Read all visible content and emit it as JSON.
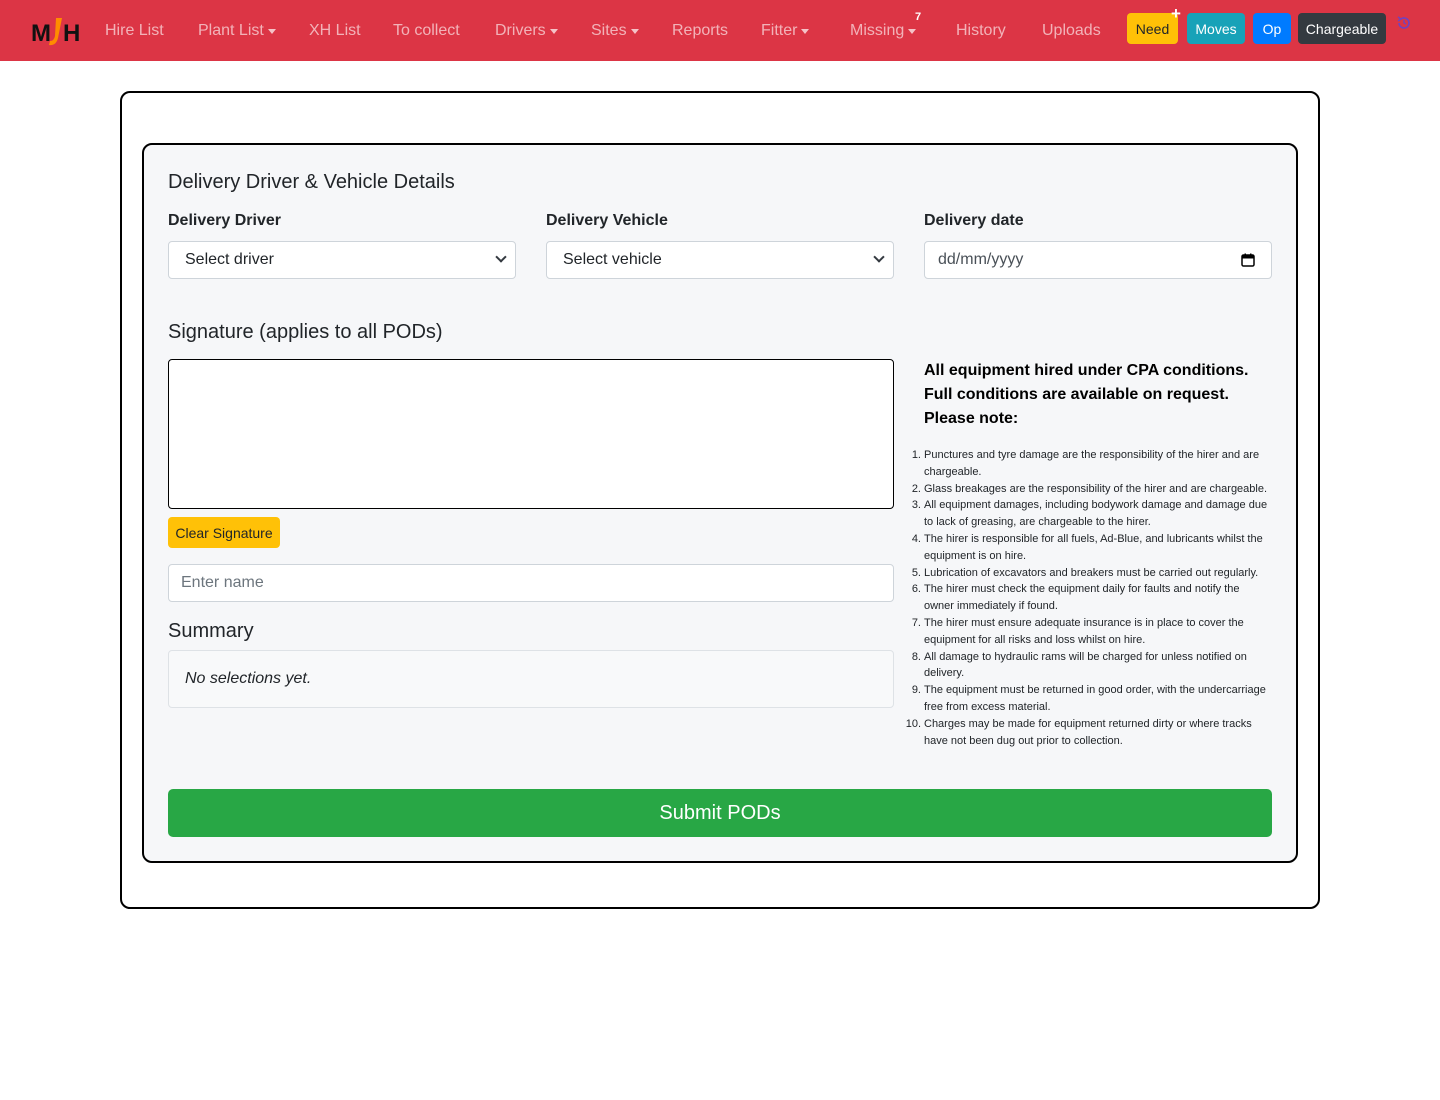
{
  "nav": {
    "brand": "MJH",
    "items": [
      {
        "label": "Hire List",
        "dropdown": false
      },
      {
        "label": "Plant List",
        "dropdown": true
      },
      {
        "label": "XH List",
        "dropdown": false
      },
      {
        "label": "To collect",
        "dropdown": false
      },
      {
        "label": "Drivers",
        "dropdown": true
      },
      {
        "label": "Sites",
        "dropdown": true
      },
      {
        "label": "Reports",
        "dropdown": false
      },
      {
        "label": "Fitter",
        "dropdown": true
      },
      {
        "label": "Missing",
        "dropdown": true,
        "badge": "7"
      },
      {
        "label": "History",
        "dropdown": false
      },
      {
        "label": "Uploads",
        "dropdown": false
      }
    ],
    "buttons": {
      "need": "Need",
      "moves": "Moves",
      "op": "Op",
      "chargeable": "Chargeable"
    },
    "colors": {
      "navbar": "#dc3545",
      "need": "#ffc107",
      "moves": "#17a2b8",
      "op": "#007bff",
      "chargeable": "#343a40"
    }
  },
  "form": {
    "section_title": "Delivery Driver & Vehicle Details",
    "driver": {
      "label": "Delivery Driver",
      "selected": "Select driver"
    },
    "vehicle": {
      "label": "Delivery Vehicle",
      "selected": "Select vehicle"
    },
    "date": {
      "label": "Delivery date",
      "placeholder": "dd/mm/yyyy"
    },
    "signature_title": "Signature (applies to all PODs)",
    "clear_signature": "Clear Signature",
    "name_placeholder": "Enter name",
    "summary_title": "Summary",
    "summary_empty": "No selections yet.",
    "submit": "Submit PODs"
  },
  "terms": {
    "heading_lines": [
      "All equipment hired under CPA conditions.",
      "Full conditions are available on request.",
      "Please note:"
    ],
    "items": [
      "Punctures and tyre damage are the responsibility of the hirer and are chargeable.",
      "Glass breakages are the responsibility of the hirer and are chargeable.",
      "All equipment damages, including bodywork damage and damage due to lack of greasing, are chargeable to the hirer.",
      "The hirer is responsible for all fuels, Ad-Blue, and lubricants whilst the equipment is on hire.",
      "Lubrication of excavators and breakers must be carried out regularly.",
      "The hirer must check the equipment daily for faults and notify the owner immediately if found.",
      "The hirer must ensure adequate insurance is in place to cover the equipment for all risks and loss whilst on hire.",
      "All damage to hydraulic rams will be charged for unless notified on delivery.",
      "The equipment must be returned in good order, with the undercarriage free from excess material.",
      "Charges may be made for equipment returned dirty or where tracks have not been dug out prior to collection."
    ]
  }
}
